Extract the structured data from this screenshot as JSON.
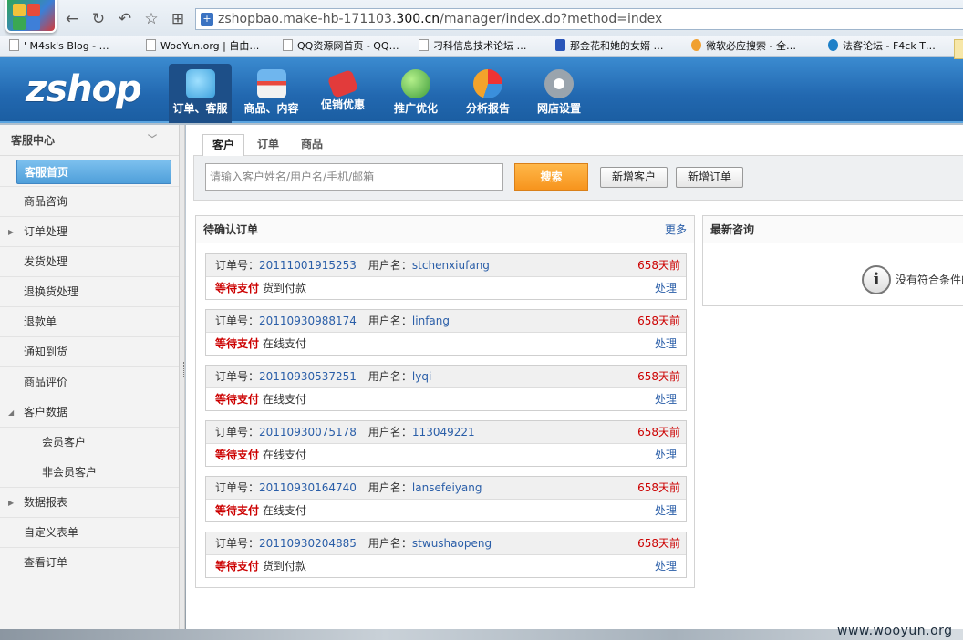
{
  "browser": {
    "url_prefix": "zshopbao.make-hb-171103.",
    "url_domain": "300.cn",
    "url_path": "/manager/index.do?method=index",
    "bookmarks": [
      "' M4sk's Blog - …",
      "WooYun.org | 自由…",
      "QQ资源网首页 - QQ…",
      "刁科信息技术论坛 …",
      "那金花和她的女婿 …",
      "微软必应搜索 - 全…",
      "法客论坛 - F4ck T…"
    ]
  },
  "app": {
    "logo": "zshop",
    "nav": [
      {
        "label": "订单、客服",
        "icon": "chat-bubbles-icon",
        "color": "#5fb2e6"
      },
      {
        "label": "商品、内容",
        "icon": "storefront-icon",
        "color": "#3e8fd3"
      },
      {
        "label": "促销优惠",
        "icon": "sale-tag-icon",
        "color": "#e23b3b"
      },
      {
        "label": "推广优化",
        "icon": "globe-icon",
        "color": "#4fb04a"
      },
      {
        "label": "分析报告",
        "icon": "pie-chart-icon",
        "color": "#f3a32b"
      },
      {
        "label": "网店设置",
        "icon": "gear-icon",
        "color": "#9aa4ad"
      }
    ]
  },
  "sidebar": {
    "title": "客服中心",
    "items": [
      {
        "label": "客服首页"
      },
      {
        "label": "商品咨询"
      },
      {
        "label": "订单处理"
      },
      {
        "label": "发货处理"
      },
      {
        "label": "退换货处理"
      },
      {
        "label": "退款单"
      },
      {
        "label": "通知到货"
      },
      {
        "label": "商品评价"
      },
      {
        "label": "客户数据"
      },
      {
        "label": "会员客户"
      },
      {
        "label": "非会员客户"
      },
      {
        "label": "数据报表"
      },
      {
        "label": "自定义表单"
      },
      {
        "label": "查看订单"
      }
    ]
  },
  "main": {
    "tabs": [
      "客户",
      "订单",
      "商品"
    ],
    "search": {
      "placeholder": "请输入客户姓名/用户名/手机/邮箱",
      "button": "搜索",
      "add_customer": "新增客户",
      "add_order": "新增订单"
    },
    "pending": {
      "title": "待确认订单",
      "more": "更多",
      "order_no_label": "订单号：",
      "user_label": "用户名：",
      "action": "处理",
      "orders": [
        {
          "no": "20111001915253",
          "user": "stchenxiufang",
          "ago": "658天前",
          "status": "等待支付",
          "pay": "货到付款"
        },
        {
          "no": "20110930988174",
          "user": "linfang",
          "ago": "658天前",
          "status": "等待支付",
          "pay": "在线支付"
        },
        {
          "no": "20110930537251",
          "user": "lyqi",
          "ago": "658天前",
          "status": "等待支付",
          "pay": "在线支付"
        },
        {
          "no": "20110930075178",
          "user": "113049221",
          "ago": "658天前",
          "status": "等待支付",
          "pay": "在线支付"
        },
        {
          "no": "20110930164740",
          "user": "lansefeiyang",
          "ago": "658天前",
          "status": "等待支付",
          "pay": "在线支付"
        },
        {
          "no": "20110930204885",
          "user": "stwushaopeng",
          "ago": "658天前",
          "status": "等待支付",
          "pay": "货到付款"
        }
      ]
    },
    "consult": {
      "title": "最新咨询",
      "empty": "没有符合条件的"
    }
  },
  "watermark": "www.wooyun.org"
}
